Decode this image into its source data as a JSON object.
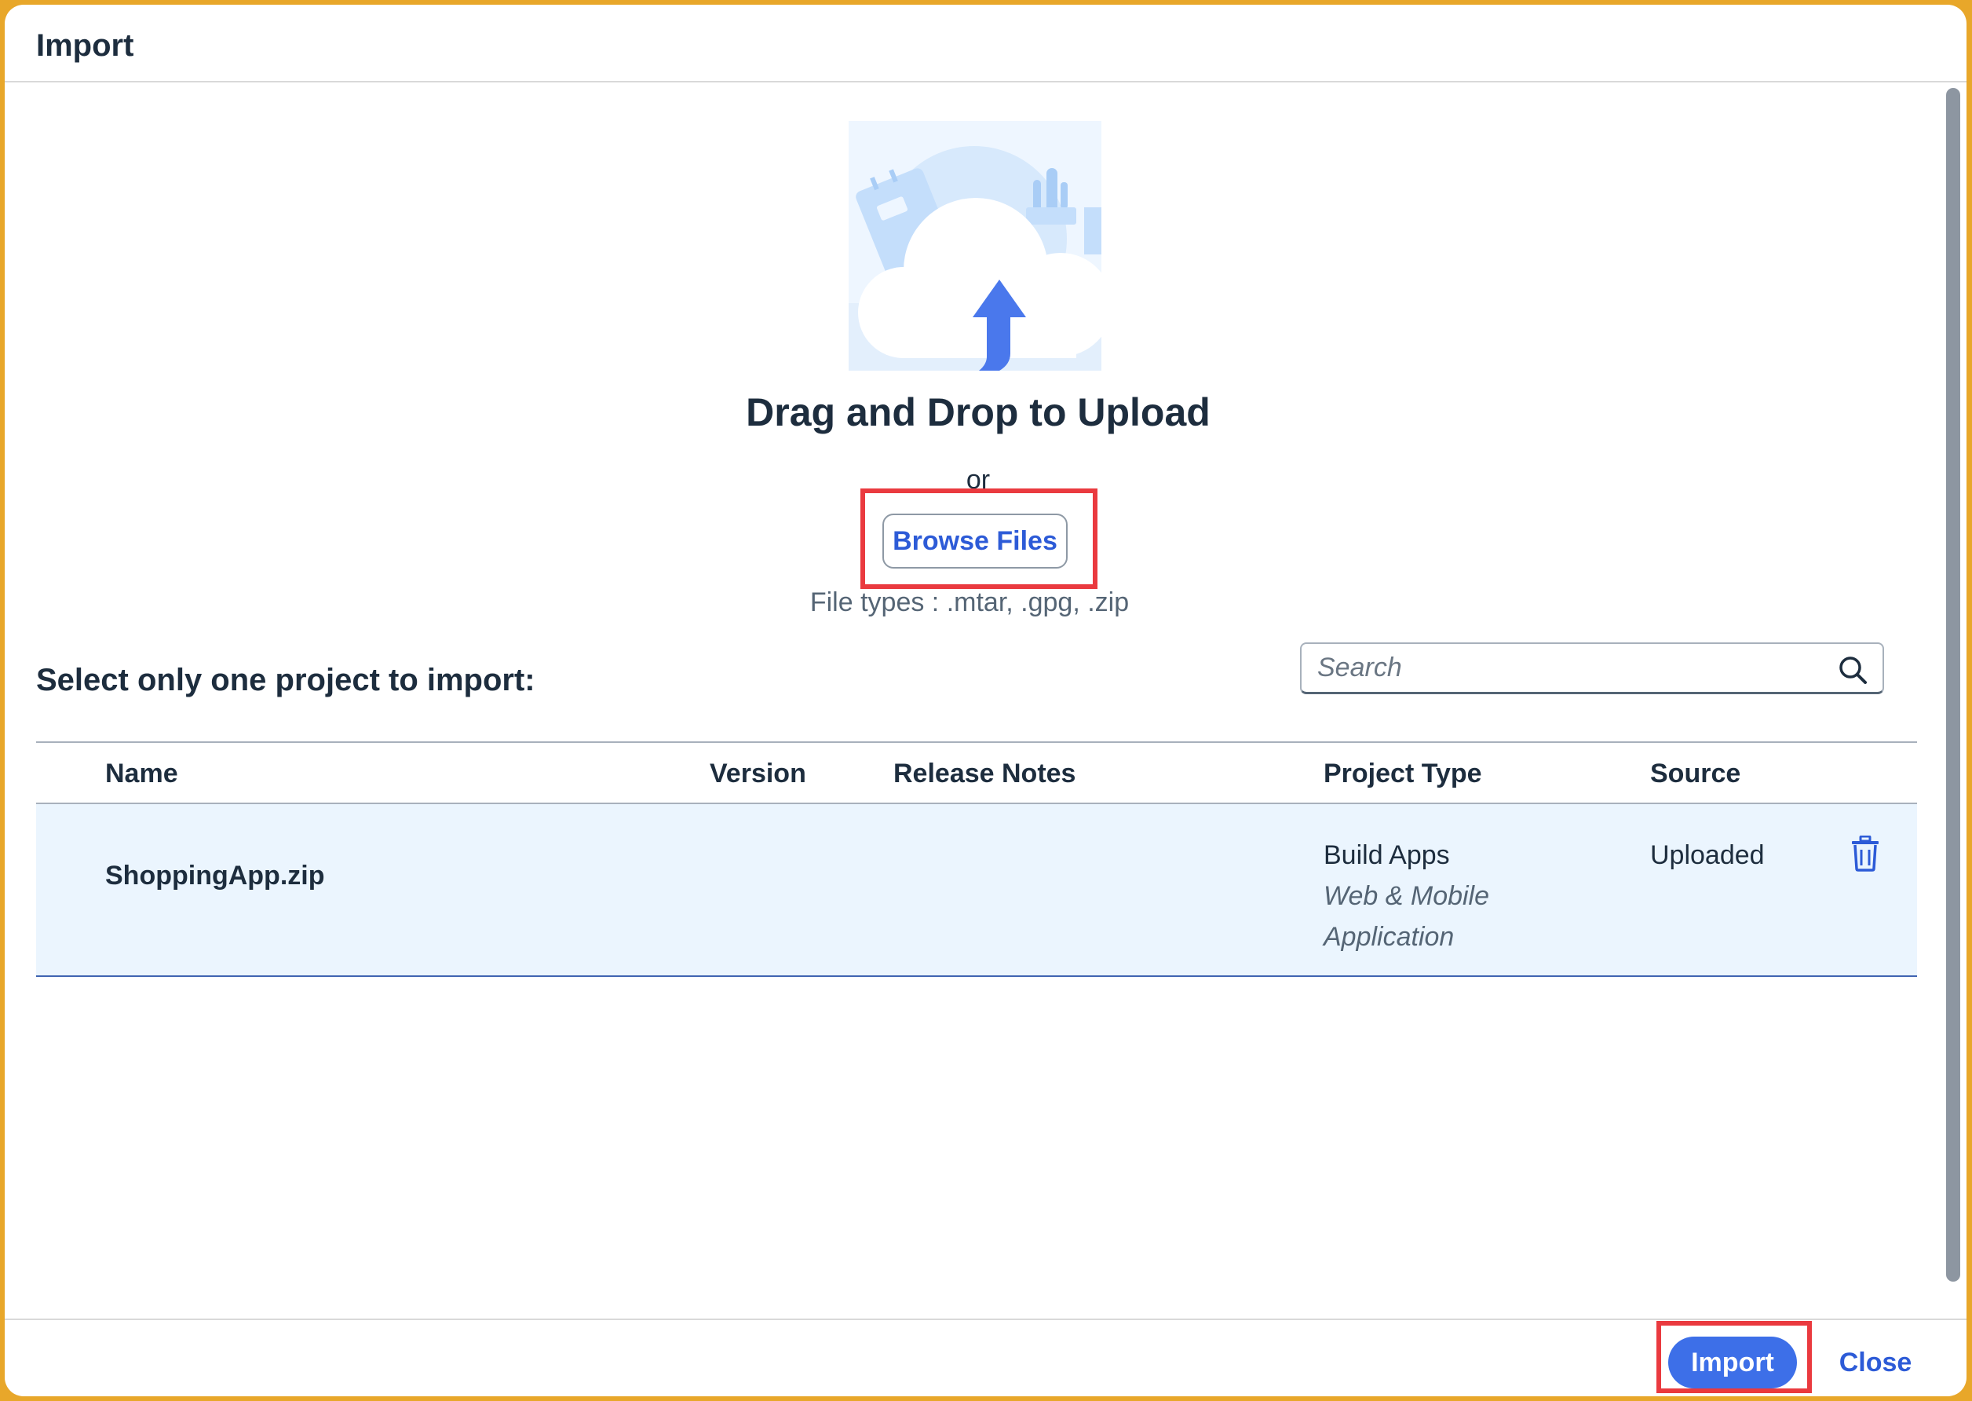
{
  "dialog": {
    "title": "Import"
  },
  "upload": {
    "title": "Drag and Drop to Upload",
    "or_text": "or",
    "browse_label": "Browse Files",
    "file_types": "File types : .mtar, .gpg, .zip"
  },
  "selection": {
    "label": "Select only one project to import:"
  },
  "search": {
    "placeholder": "Search"
  },
  "table": {
    "columns": [
      "Name",
      "Version",
      "Release Notes",
      "Project Type",
      "Source"
    ],
    "rows": [
      {
        "name": "ShoppingApp.zip",
        "version": "",
        "release_notes": "",
        "project_type": "Build Apps",
        "project_subtype_line1": "Web & Mobile",
        "project_subtype_line2": "Application",
        "source": "Uploaded"
      }
    ]
  },
  "footer": {
    "import_label": "Import",
    "close_label": "Close"
  },
  "icons": [
    "cloud-upload-illustration",
    "search-icon",
    "trash-icon"
  ],
  "colors": {
    "accent": "#3d6fe8",
    "link": "#2d5bd7",
    "highlight": "#ea3a3f",
    "row_selected": "#ebf5fe"
  }
}
